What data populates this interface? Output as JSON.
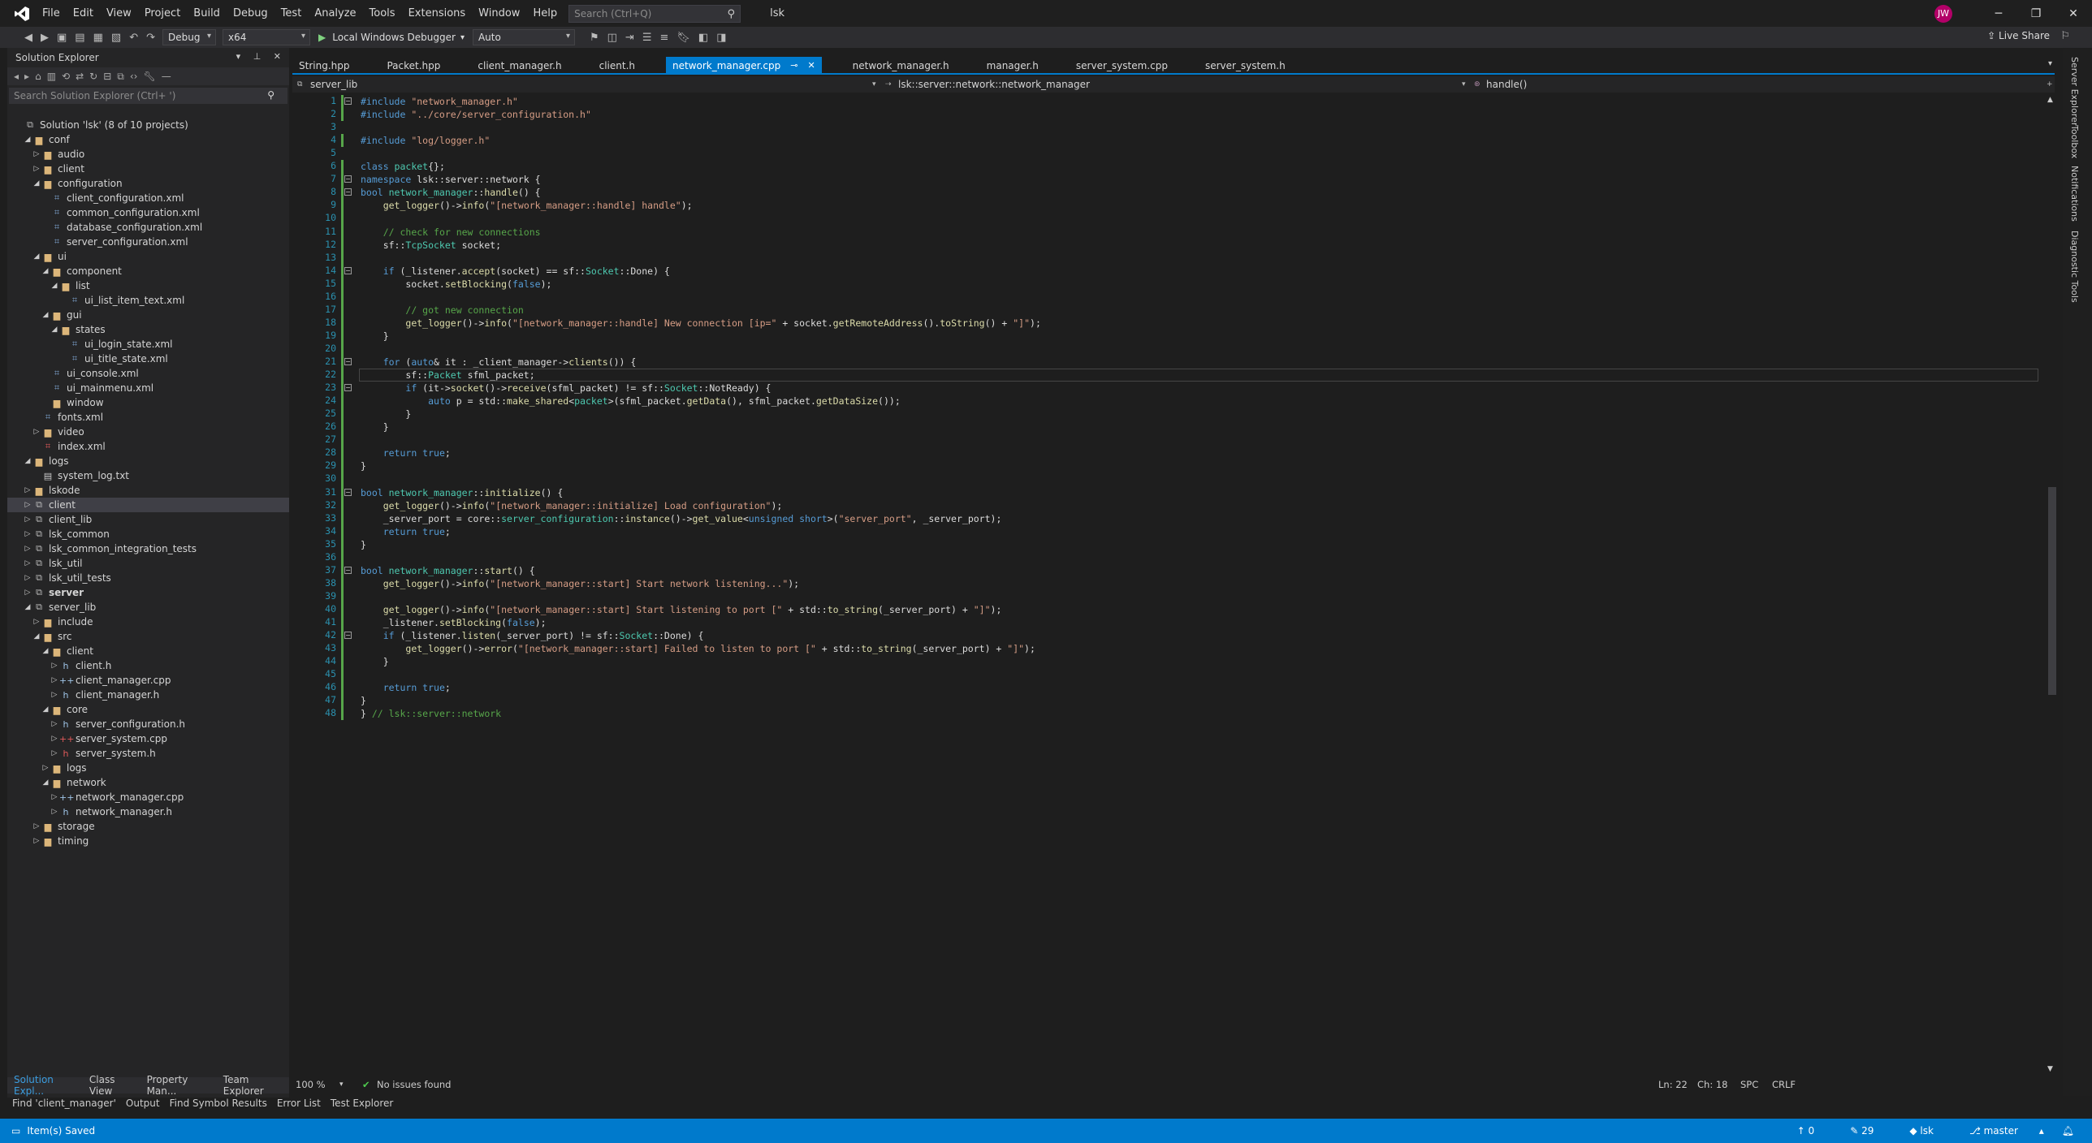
{
  "menu": [
    "File",
    "Edit",
    "View",
    "Project",
    "Build",
    "Debug",
    "Test",
    "Analyze",
    "Tools",
    "Extensions",
    "Window",
    "Help"
  ],
  "search": {
    "placeholder": "Search (Ctrl+Q)"
  },
  "solution_name": "lsk",
  "user_initials": "JW",
  "toolbar": {
    "config": "Debug",
    "platform": "x64",
    "debugger": "Local Windows Debugger",
    "mode": "Auto",
    "live_share": "Live Share"
  },
  "solution_explorer": {
    "title": "Solution Explorer",
    "search_placeholder": "Search Solution Explorer (Ctrl+ ')",
    "items": [
      {
        "level": 0,
        "arrow": "",
        "icon": "solution",
        "label": "Solution 'lsk' (8 of 10 projects)"
      },
      {
        "level": 1,
        "arrow": "open",
        "icon": "folder",
        "label": "conf"
      },
      {
        "level": 2,
        "arrow": "closed",
        "icon": "folder",
        "label": "audio"
      },
      {
        "level": 2,
        "arrow": "closed",
        "icon": "folder",
        "label": "client"
      },
      {
        "level": 2,
        "arrow": "open",
        "icon": "folder",
        "label": "configuration"
      },
      {
        "level": 3,
        "arrow": "",
        "icon": "xml",
        "label": "client_configuration.xml"
      },
      {
        "level": 3,
        "arrow": "",
        "icon": "xml",
        "label": "common_configuration.xml"
      },
      {
        "level": 3,
        "arrow": "",
        "icon": "xml",
        "label": "database_configuration.xml"
      },
      {
        "level": 3,
        "arrow": "",
        "icon": "xml",
        "label": "server_configuration.xml"
      },
      {
        "level": 2,
        "arrow": "open",
        "icon": "folder",
        "label": "ui"
      },
      {
        "level": 3,
        "arrow": "open",
        "icon": "folder",
        "label": "component"
      },
      {
        "level": 4,
        "arrow": "open",
        "icon": "folder",
        "label": "list"
      },
      {
        "level": 5,
        "arrow": "",
        "icon": "xml",
        "label": "ui_list_item_text.xml"
      },
      {
        "level": 3,
        "arrow": "open",
        "icon": "folder",
        "label": "gui"
      },
      {
        "level": 4,
        "arrow": "open",
        "icon": "folder",
        "label": "states"
      },
      {
        "level": 5,
        "arrow": "",
        "icon": "xml",
        "label": "ui_login_state.xml"
      },
      {
        "level": 5,
        "arrow": "",
        "icon": "xml",
        "label": "ui_title_state.xml"
      },
      {
        "level": 3,
        "arrow": "",
        "icon": "xml",
        "label": "ui_console.xml"
      },
      {
        "level": 3,
        "arrow": "",
        "icon": "xml",
        "label": "ui_mainmenu.xml"
      },
      {
        "level": 3,
        "arrow": "",
        "icon": "folder",
        "label": "window"
      },
      {
        "level": 2,
        "arrow": "",
        "icon": "xml",
        "label": "fonts.xml"
      },
      {
        "level": 2,
        "arrow": "closed",
        "icon": "folder",
        "label": "video"
      },
      {
        "level": 2,
        "arrow": "",
        "icon": "xmlred",
        "label": "index.xml"
      },
      {
        "level": 1,
        "arrow": "open",
        "icon": "folder",
        "label": "logs"
      },
      {
        "level": 2,
        "arrow": "",
        "icon": "txt",
        "label": "system_log.txt"
      },
      {
        "level": 1,
        "arrow": "closed",
        "icon": "folder",
        "label": "lskode"
      },
      {
        "level": 1,
        "arrow": "closed",
        "icon": "project",
        "label": "client",
        "selected": true
      },
      {
        "level": 1,
        "arrow": "closed",
        "icon": "project",
        "label": "client_lib"
      },
      {
        "level": 1,
        "arrow": "closed",
        "icon": "project",
        "label": "lsk_common"
      },
      {
        "level": 1,
        "arrow": "closed",
        "icon": "project",
        "label": "lsk_common_integration_tests"
      },
      {
        "level": 1,
        "arrow": "closed",
        "icon": "project",
        "label": "lsk_util"
      },
      {
        "level": 1,
        "arrow": "closed",
        "icon": "project",
        "label": "lsk_util_tests"
      },
      {
        "level": 1,
        "arrow": "closed",
        "icon": "project",
        "label": "server",
        "bold": true
      },
      {
        "level": 1,
        "arrow": "open",
        "icon": "project",
        "label": "server_lib"
      },
      {
        "level": 2,
        "arrow": "closed",
        "icon": "folder",
        "label": "include"
      },
      {
        "level": 2,
        "arrow": "open",
        "icon": "folder",
        "label": "src"
      },
      {
        "level": 3,
        "arrow": "open",
        "icon": "folder",
        "label": "client"
      },
      {
        "level": 4,
        "arrow": "closed",
        "icon": "h",
        "label": "client.h"
      },
      {
        "level": 4,
        "arrow": "closed",
        "icon": "cpp",
        "label": "client_manager.cpp"
      },
      {
        "level": 4,
        "arrow": "closed",
        "icon": "h",
        "label": "client_manager.h"
      },
      {
        "level": 3,
        "arrow": "open",
        "icon": "folder",
        "label": "core"
      },
      {
        "level": 4,
        "arrow": "closed",
        "icon": "h",
        "label": "server_configuration.h"
      },
      {
        "level": 4,
        "arrow": "closed",
        "icon": "cppred",
        "label": "server_system.cpp"
      },
      {
        "level": 4,
        "arrow": "closed",
        "icon": "hred",
        "label": "server_system.h"
      },
      {
        "level": 3,
        "arrow": "closed",
        "icon": "folder",
        "label": "logs"
      },
      {
        "level": 3,
        "arrow": "open",
        "icon": "folder",
        "label": "network"
      },
      {
        "level": 4,
        "arrow": "closed",
        "icon": "cpp",
        "label": "network_manager.cpp"
      },
      {
        "level": 4,
        "arrow": "closed",
        "icon": "h",
        "label": "network_manager.h"
      },
      {
        "level": 2,
        "arrow": "closed",
        "icon": "folder",
        "label": "storage"
      },
      {
        "level": 2,
        "arrow": "closed",
        "icon": "folder",
        "label": "timing"
      }
    ],
    "bottom_tabs": [
      "Solution Expl...",
      "Class View",
      "Property Man...",
      "Team Explorer"
    ]
  },
  "tabs": [
    {
      "label": "String.hpp"
    },
    {
      "label": "Packet.hpp"
    },
    {
      "label": "client_manager.h"
    },
    {
      "label": "client.h"
    },
    {
      "label": "network_manager.cpp",
      "active": true
    },
    {
      "label": "network_manager.h"
    },
    {
      "label": "manager.h"
    },
    {
      "label": "server_system.cpp"
    },
    {
      "label": "server_system.h"
    }
  ],
  "navbar": {
    "project": "server_lib",
    "scope": "lsk::server::network::network_manager",
    "member": "handle()"
  },
  "code_lines": [
    [
      [
        "pp",
        "#include "
      ],
      [
        "st",
        "\"network_manager.h\""
      ]
    ],
    [
      [
        "pp",
        "#include "
      ],
      [
        "st",
        "\"../core/server_configuration.h\""
      ]
    ],
    [],
    [
      [
        "pp",
        "#include "
      ],
      [
        "st",
        "\"log/logger.h\""
      ]
    ],
    [],
    [
      [
        "kw",
        "class "
      ],
      [
        "ty",
        "packet"
      ],
      [
        "t",
        "{};"
      ]
    ],
    [
      [
        "kw",
        "namespace "
      ],
      [
        "t",
        "lsk::server::network {"
      ]
    ],
    [
      [
        "kw",
        "bool "
      ],
      [
        "ty",
        "network_manager"
      ],
      [
        "t",
        "::"
      ],
      [
        "fn",
        "handle"
      ],
      [
        "t",
        "() {"
      ]
    ],
    [
      [
        "t",
        "    "
      ],
      [
        "fn",
        "get_logger"
      ],
      [
        "t",
        "()->"
      ],
      [
        "fn",
        "info"
      ],
      [
        "t",
        "("
      ],
      [
        "st",
        "\"[network_manager::handle] handle\""
      ],
      [
        "t",
        ");"
      ]
    ],
    [],
    [
      [
        "t",
        "    "
      ],
      [
        "cm",
        "// check for new connections"
      ]
    ],
    [
      [
        "t",
        "    sf::"
      ],
      [
        "ty",
        "TcpSocket"
      ],
      [
        "t",
        " socket;"
      ]
    ],
    [],
    [
      [
        "t",
        "    "
      ],
      [
        "kw",
        "if "
      ],
      [
        "t",
        "(_listener."
      ],
      [
        "fn",
        "accept"
      ],
      [
        "t",
        "(socket) == sf::"
      ],
      [
        "ty",
        "Socket"
      ],
      [
        "t",
        "::Done) {"
      ]
    ],
    [
      [
        "t",
        "        socket."
      ],
      [
        "fn",
        "setBlocking"
      ],
      [
        "t",
        "("
      ],
      [
        "kw",
        "false"
      ],
      [
        "t",
        ");"
      ]
    ],
    [],
    [
      [
        "t",
        "        "
      ],
      [
        "cm",
        "// got new connection"
      ]
    ],
    [
      [
        "t",
        "        "
      ],
      [
        "fn",
        "get_logger"
      ],
      [
        "t",
        "()->"
      ],
      [
        "fn",
        "info"
      ],
      [
        "t",
        "("
      ],
      [
        "st",
        "\"[network_manager::handle] New connection [ip=\""
      ],
      [
        "t",
        " + socket."
      ],
      [
        "fn",
        "getRemoteAddress"
      ],
      [
        "t",
        "()."
      ],
      [
        "fn",
        "toString"
      ],
      [
        "t",
        "() + "
      ],
      [
        "st",
        "\"]\""
      ],
      [
        "t",
        ");"
      ]
    ],
    [
      [
        "t",
        "    }"
      ]
    ],
    [],
    [
      [
        "t",
        "    "
      ],
      [
        "kw",
        "for "
      ],
      [
        "t",
        "("
      ],
      [
        "kw",
        "auto"
      ],
      [
        "t",
        "& it : _client_manager->"
      ],
      [
        "fn",
        "clients"
      ],
      [
        "t",
        "()) {"
      ]
    ],
    [
      [
        "t",
        "        sf::"
      ],
      [
        "ty",
        "Packet"
      ],
      [
        "t",
        " sfml_packet;"
      ]
    ],
    [
      [
        "t",
        "        "
      ],
      [
        "kw",
        "if "
      ],
      [
        "t",
        "(it->"
      ],
      [
        "fn",
        "socket"
      ],
      [
        "t",
        "()->"
      ],
      [
        "fn",
        "receive"
      ],
      [
        "t",
        "(sfml_packet) != sf::"
      ],
      [
        "ty",
        "Socket"
      ],
      [
        "t",
        "::NotReady) {"
      ]
    ],
    [
      [
        "t",
        "            "
      ],
      [
        "kw",
        "auto "
      ],
      [
        "t",
        "p = std::"
      ],
      [
        "fn",
        "make_shared"
      ],
      [
        "t",
        "<"
      ],
      [
        "ty",
        "packet"
      ],
      [
        "t",
        ">(sfml_packet."
      ],
      [
        "fn",
        "getData"
      ],
      [
        "t",
        "(), sfml_packet."
      ],
      [
        "fn",
        "getDataSize"
      ],
      [
        "t",
        "());"
      ]
    ],
    [
      [
        "t",
        "        }"
      ]
    ],
    [
      [
        "t",
        "    }"
      ]
    ],
    [],
    [
      [
        "t",
        "    "
      ],
      [
        "kw",
        "return "
      ],
      [
        "kw",
        "true"
      ],
      [
        "t",
        ";"
      ]
    ],
    [
      [
        "t",
        "}"
      ]
    ],
    [],
    [
      [
        "kw",
        "bool "
      ],
      [
        "ty",
        "network_manager"
      ],
      [
        "t",
        "::"
      ],
      [
        "fn",
        "initialize"
      ],
      [
        "t",
        "() {"
      ]
    ],
    [
      [
        "t",
        "    "
      ],
      [
        "fn",
        "get_logger"
      ],
      [
        "t",
        "()->"
      ],
      [
        "fn",
        "info"
      ],
      [
        "t",
        "("
      ],
      [
        "st",
        "\"[network_manager::initialize] Load configuration\""
      ],
      [
        "t",
        ");"
      ]
    ],
    [
      [
        "t",
        "    _server_port = core::"
      ],
      [
        "ty",
        "server_configuration"
      ],
      [
        "t",
        "::"
      ],
      [
        "fn",
        "instance"
      ],
      [
        "t",
        "()->"
      ],
      [
        "fn",
        "get_value"
      ],
      [
        "t",
        "<"
      ],
      [
        "kw",
        "unsigned short"
      ],
      [
        "t",
        ">("
      ],
      [
        "st",
        "\"server_port\""
      ],
      [
        "t",
        ", _server_port);"
      ]
    ],
    [
      [
        "t",
        "    "
      ],
      [
        "kw",
        "return "
      ],
      [
        "kw",
        "true"
      ],
      [
        "t",
        ";"
      ]
    ],
    [
      [
        "t",
        "}"
      ]
    ],
    [],
    [
      [
        "kw",
        "bool "
      ],
      [
        "ty",
        "network_manager"
      ],
      [
        "t",
        "::"
      ],
      [
        "fn",
        "start"
      ],
      [
        "t",
        "() {"
      ]
    ],
    [
      [
        "t",
        "    "
      ],
      [
        "fn",
        "get_logger"
      ],
      [
        "t",
        "()->"
      ],
      [
        "fn",
        "info"
      ],
      [
        "t",
        "("
      ],
      [
        "st",
        "\"[network_manager::start] Start network listening...\""
      ],
      [
        "t",
        ");"
      ]
    ],
    [],
    [
      [
        "t",
        "    "
      ],
      [
        "fn",
        "get_logger"
      ],
      [
        "t",
        "()->"
      ],
      [
        "fn",
        "info"
      ],
      [
        "t",
        "("
      ],
      [
        "st",
        "\"[network_manager::start] Start listening to port [\""
      ],
      [
        "t",
        " + std::"
      ],
      [
        "fn",
        "to_string"
      ],
      [
        "t",
        "(_server_port) + "
      ],
      [
        "st",
        "\"]\""
      ],
      [
        "t",
        ");"
      ]
    ],
    [
      [
        "t",
        "    _listener."
      ],
      [
        "fn",
        "setBlocking"
      ],
      [
        "t",
        "("
      ],
      [
        "kw",
        "false"
      ],
      [
        "t",
        ");"
      ]
    ],
    [
      [
        "t",
        "    "
      ],
      [
        "kw",
        "if "
      ],
      [
        "t",
        "(_listener."
      ],
      [
        "fn",
        "listen"
      ],
      [
        "t",
        "(_server_port) != sf::"
      ],
      [
        "ty",
        "Socket"
      ],
      [
        "t",
        "::Done) {"
      ]
    ],
    [
      [
        "t",
        "        "
      ],
      [
        "fn",
        "get_logger"
      ],
      [
        "t",
        "()->"
      ],
      [
        "fn",
        "error"
      ],
      [
        "t",
        "("
      ],
      [
        "st",
        "\"[network_manager::start] Failed to listen to port [\""
      ],
      [
        "t",
        " + std::"
      ],
      [
        "fn",
        "to_string"
      ],
      [
        "t",
        "(_server_port) + "
      ],
      [
        "st",
        "\"]\""
      ],
      [
        "t",
        ");"
      ]
    ],
    [
      [
        "t",
        "    }"
      ]
    ],
    [],
    [
      [
        "t",
        "    "
      ],
      [
        "kw",
        "return "
      ],
      [
        "kw",
        "true"
      ],
      [
        "t",
        ";"
      ]
    ],
    [
      [
        "t",
        "}"
      ]
    ],
    [
      [
        "t",
        "} "
      ],
      [
        "cm",
        "// lsk::server::network"
      ]
    ]
  ],
  "editor_status": {
    "zoom": "100 %",
    "issues": "No issues found",
    "ln": "Ln: 22",
    "ch": "Ch: 18",
    "ws": "SPC",
    "eol": "CRLF"
  },
  "output_tabs": [
    "Find 'client_manager'",
    "Output",
    "Find Symbol Results",
    "Error List",
    "Test Explorer"
  ],
  "right_rail": [
    "Server Explorer",
    "Toolbox",
    "Notifications",
    "Diagnostic Tools"
  ],
  "statusbar": {
    "message": "Item(s) Saved",
    "up": "0",
    "edits": "29",
    "repo": "lsk",
    "branch": "master"
  }
}
